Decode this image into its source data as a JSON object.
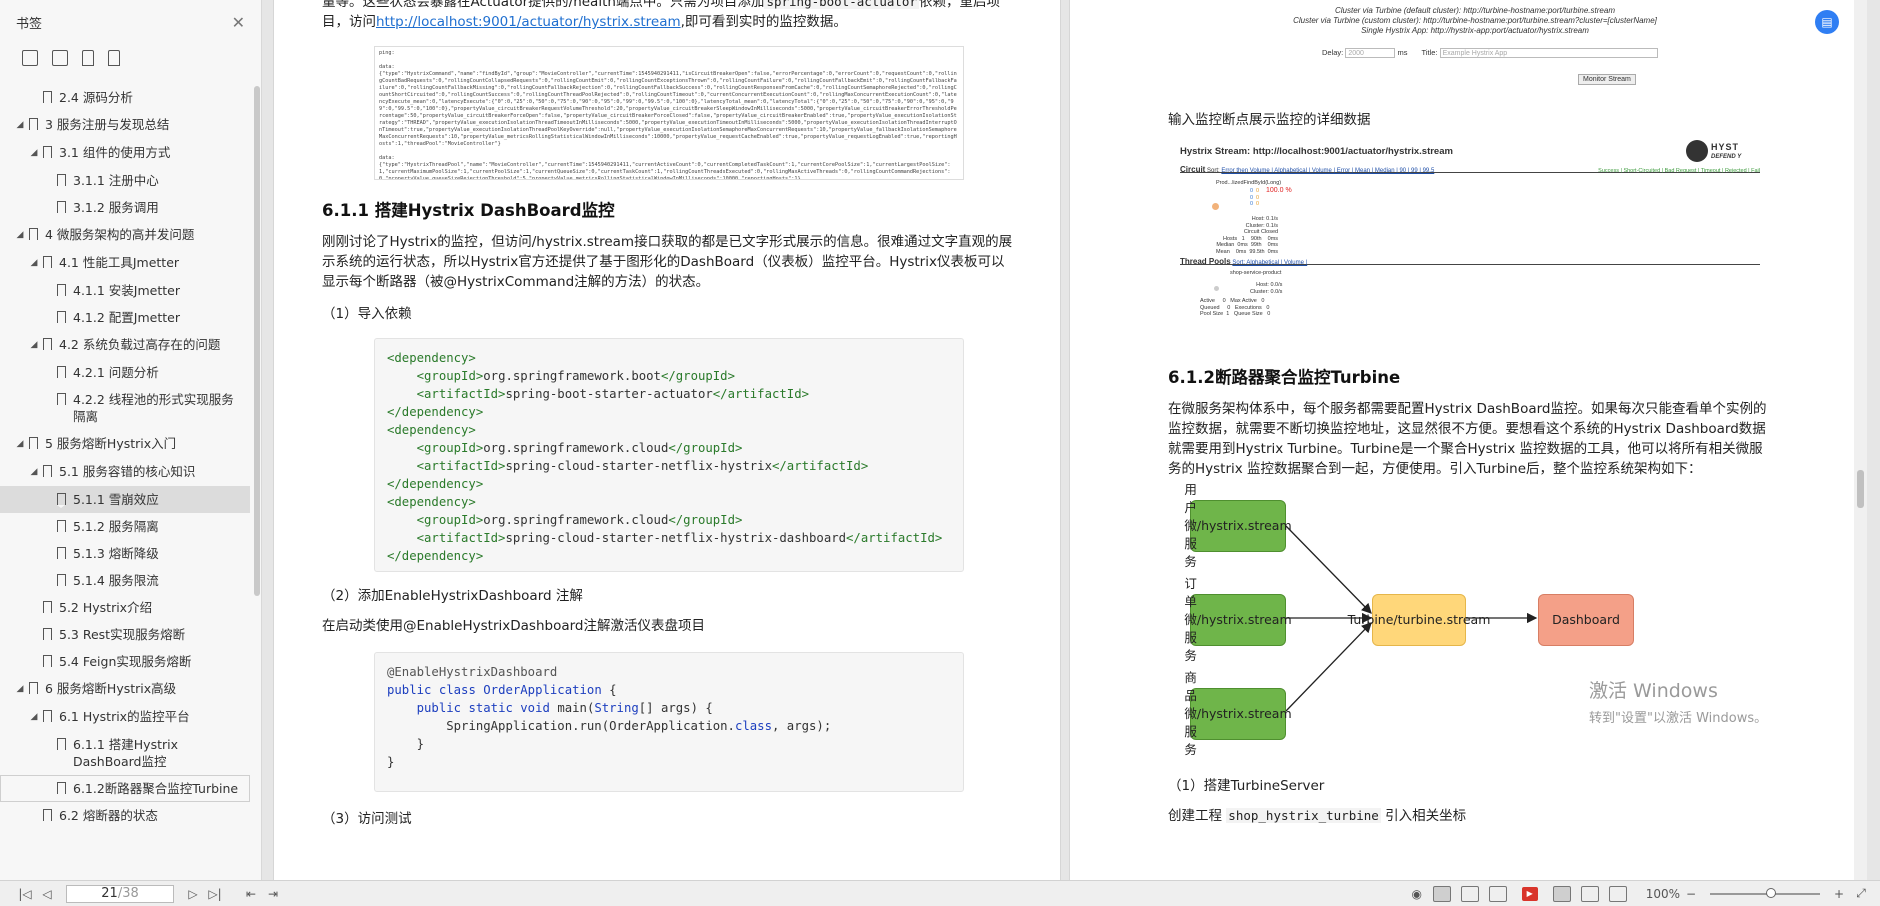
{
  "sidebar": {
    "title": "书签",
    "close_icon": "close-icon",
    "tools": [
      "expand-all-icon",
      "collapse-all-icon",
      "add-bookmark-icon",
      "bookmark-icon"
    ],
    "items": [
      {
        "label": "2.4 源码分析",
        "level": 2,
        "arrow": ""
      },
      {
        "label": "3 服务注册与发现总结",
        "level": 1,
        "arrow": "◢"
      },
      {
        "label": "3.1 组件的使用方式",
        "level": 2,
        "arrow": "◢"
      },
      {
        "label": "3.1.1 注册中心",
        "level": 3,
        "arrow": ""
      },
      {
        "label": "3.1.2 服务调用",
        "level": 3,
        "arrow": ""
      },
      {
        "label": "4 微服务架构的高并发问题",
        "level": 1,
        "arrow": "◢"
      },
      {
        "label": "4.1 性能工具Jmetter",
        "level": 2,
        "arrow": "◢"
      },
      {
        "label": "4.1.1 安装Jmetter",
        "level": 3,
        "arrow": ""
      },
      {
        "label": "4.1.2 配置Jmetter",
        "level": 3,
        "arrow": ""
      },
      {
        "label": "4.2 系统负载过高存在的问题",
        "level": 2,
        "arrow": "◢"
      },
      {
        "label": "4.2.1 问题分析",
        "level": 3,
        "arrow": ""
      },
      {
        "label": "4.2.2 线程池的形式实现服务隔离",
        "level": 3,
        "arrow": ""
      },
      {
        "label": "5 服务熔断Hystrix入门",
        "level": 1,
        "arrow": "◢"
      },
      {
        "label": "5.1 服务容错的核心知识",
        "level": 2,
        "arrow": "◢"
      },
      {
        "label": "5.1.1 雪崩效应",
        "level": 3,
        "arrow": "",
        "selected": true
      },
      {
        "label": "5.1.2 服务隔离",
        "level": 3,
        "arrow": ""
      },
      {
        "label": "5.1.3 熔断降级",
        "level": 3,
        "arrow": ""
      },
      {
        "label": "5.1.4 服务限流",
        "level": 3,
        "arrow": ""
      },
      {
        "label": "5.2 Hystrix介绍",
        "level": 2,
        "arrow": ""
      },
      {
        "label": "5.3 Rest实现服务熔断",
        "level": 2,
        "arrow": ""
      },
      {
        "label": "5.4 Feign实现服务熔断",
        "level": 2,
        "arrow": ""
      },
      {
        "label": "6 服务熔断Hystrix高级",
        "level": 1,
        "arrow": "◢"
      },
      {
        "label": "6.1 Hystrix的监控平台",
        "level": 2,
        "arrow": "◢"
      },
      {
        "label": "6.1.1 搭建Hystrix DashBoard监控",
        "level": 3,
        "arrow": ""
      },
      {
        "label": "6.1.2断路器聚合监控Turbine",
        "level": 3,
        "arrow": "",
        "boxed": true
      },
      {
        "label": "6.2 熔断器的状态",
        "level": 2,
        "arrow": ""
      }
    ]
  },
  "left_page": {
    "intro_1": "量等。这些状态会暴露在Actuator提供的/health端点中。只需为项目添加",
    "intro_code": "spring-boot-actuator",
    "intro_2": "依赖，重启项目，访问",
    "intro_link": "http://localhost:9001/actuator/hystrix.stream",
    "intro_3": ",即可看到实时的监控数据。",
    "raw_lines": [
      "ping:",
      "",
      "data:",
      "{\"type\":\"HystrixCommand\",\"name\":\"findById\",\"group\":\"MovieController\",\"currentTime\":1545940291411,\"isCircuitBreakerOpen\":false,\"errorPercentage\":0,\"errorCount\":0,\"requestCount\":0,\"rollingCountBadRequests\":0,\"rollingCountCollapsedRequests\":0,\"rollingCountEmit\":0,\"rollingCountExceptionsThrown\":0,\"rollingCountFailure\":0,\"rollingCountFallbackEmit\":0,\"rollingCountFallbackFailure\":0,\"rollingCountFallbackMissing\":0,\"rollingCountFallbackRejection\":0,\"rollingCountFallbackSuccess\":0,\"rollingCountResponsesFromCache\":0,\"rollingCountSemaphoreRejected\":0,\"rollingCountShortCircuited\":0,\"rollingCountSuccess\":0,\"rollingCountThreadPoolRejected\":0,\"rollingCountTimeout\":0,\"currentConcurrentExecutionCount\":0,\"rollingMaxConcurrentExecutionCount\":0,\"latencyExecute_mean\":0,\"latencyExecute\":{\"0\":0,\"25\":0,\"50\":0,\"75\":0,\"90\":0,\"95\":0,\"99\":0,\"99.5\":0,\"100\":0},\"latencyTotal_mean\":0,\"latencyTotal\":{\"0\":0,\"25\":0,\"50\":0,\"75\":0,\"90\":0,\"95\":0,\"99\":0,\"99.5\":0,\"100\":0},\"propertyValue_circuitBreakerRequestVolumeThreshold\":20,\"propertyValue_circuitBreakerSleepWindowInMilliseconds\":5000,\"propertyValue_circuitBreakerErrorThresholdPercentage\":50,\"propertyValue_circuitBreakerForceOpen\":false,\"propertyValue_circuitBreakerForceClosed\":false,\"propertyValue_circuitBreakerEnabled\":true,\"propertyValue_executionIsolationStrategy\":\"THREAD\",\"propertyValue_executionIsolationThreadTimeoutInMilliseconds\":5000,\"propertyValue_executionTimeoutInMilliseconds\":5000,\"propertyValue_executionIsolationThreadInterruptOnTimeout\":true,\"propertyValue_executionIsolationThreadPoolKeyOverride\":null,\"propertyValue_executionIsolationSemaphoreMaxConcurrentRequests\":10,\"propertyValue_fallbackIsolationSemaphoreMaxConcurrentRequests\":10,\"propertyValue_metricsRollingStatisticalWindowInMilliseconds\":10000,\"propertyValue_requestCacheEnabled\":true,\"propertyValue_requestLogEnabled\":true,\"reportingHosts\":1,\"threadPool\":\"MovieController\"}",
      "",
      "data:",
      "{\"type\":\"HystrixThreadPool\",\"name\":\"MovieController\",\"currentTime\":1545940291411,\"currentActiveCount\":0,\"currentCompletedTaskCount\":1,\"currentCorePoolSize\":1,\"currentLargestPoolSize\":1,\"currentMaximumPoolSize\":1,\"currentPoolSize\":1,\"currentQueueSize\":0,\"currentTaskCount\":1,\"rollingCountThreadsExecuted\":0,\"rollingMaxActiveThreads\":0,\"rollingCountCommandRejections\":0,\"propertyValue_queueSizeRejectionThreshold\":5,\"propertyValue_metricsRollingStatisticalWindowInMilliseconds\":10000,\"reportingHosts\":1}"
    ],
    "heading_611": "6.1.1 搭建Hystrix DashBoard监控",
    "para_611": "刚刚讨论了Hystrix的监控，但访问/hystrix.stream接口获取的都是已文字形式展示的信息。很难通过文字直观的展示系统的运行状态，所以Hystrix官方还提供了基于图形化的DashBoard（仪表板）监控平台。Hystrix仪表板可以显示每个断路器（被@HystrixCommand注解的方法）的状态。",
    "step1": "（1）导入依赖",
    "step2": "（2）添加EnableHystrixDashboard 注解",
    "step2_desc": "在启动类使用@EnableHystrixDashboard注解激活仪表盘项目",
    "step3": "（3）访问测试"
  },
  "deps": [
    {
      "groupId": "org.springframework.boot",
      "artifactId": "spring-boot-starter-actuator"
    },
    {
      "groupId": "org.springframework.cloud",
      "artifactId": "spring-cloud-starter-netflix-hystrix"
    },
    {
      "groupId": "org.springframework.cloud",
      "artifactId": "spring-cloud-starter-netflix-hystrix-dashboard"
    }
  ],
  "java_code": {
    "annotation": "@EnableHystrixDashboard",
    "kw_public": "public",
    "kw_class": "class",
    "class_name": "OrderApplication",
    "kw_static": "static",
    "kw_void": "void",
    "method": "main",
    "param_type": "String",
    "param": "[] args",
    "run_line": "SpringApplication.run(OrderApplication.",
    "run_class": "class",
    "run_tail": ", args);"
  },
  "right_page": {
    "turbine_default": "Cluster via Turbine (default cluster): http://turbine-hostname:port/turbine.stream",
    "turbine_custom": "Cluster via Turbine (custom cluster): http://turbine-hostname:port/turbine.stream?cluster=[clusterName]",
    "single_app": "Single Hystrix App: http://hystrix-app:port/actuator/hystrix.stream",
    "delay_label": "Delay:",
    "delay_value": "2000",
    "delay_unit": "ms",
    "title_label": "Title:",
    "title_placeholder": "Example Hystrix App",
    "monitor_button": "Monitor Stream",
    "caption": "输入监控断点展示监控的详细数据",
    "hs_title": "Hystrix Stream: http://localhost:9001/actuator/hystrix.stream",
    "hs_logo_1": "HYST",
    "hs_logo_2": "DEFEND Y",
    "hs_circuit": "Circuit",
    "hs_sort": "Sort:",
    "hs_sort_links": "Error then Volume | Alphabetical | Volume | Error | Mean | Median | 90 | 99 | 99.5",
    "hs_legend": "Success | Short-Circuited | Bad Request | Timeout | Rejected | Fail",
    "hs_cmd": "Prod...lizedFindById(Long)",
    "hs_pct": "100.0 %",
    "hs_circuit_block": "Host: 0.1/s\nCluster: 0.1/s\nCircuit Closed\nHosts   1    90th    0ms\nMedian  0ms  99th    0ms\nMean    0ms  99.5th  0ms",
    "hs_threadpools": "Thread Pools",
    "hs_tp_sort": "Sort: Alphabetical | Volume |",
    "hs_tp_name": "shop-service-product",
    "hs_tp_block": "Host: 0.0/s\nCluster: 0.0/s",
    "hs_tp_stats": "Active     0   Max Active   0\nQueued     0   Executions   0\nPool Size  1   Queue Size   0",
    "heading_612": "6.1.2断路器聚合监控Turbine",
    "para_612": "在微服务架构体系中，每个服务都需要配置Hystrix DashBoard监控。如果每次只能查看单个实例的监控数据，就需要不断切换监控地址，这显然很不方便。要想看这个系统的Hystrix Dashboard数据就需要用到Hystrix Turbine。Turbine是一个聚合Hystrix 监控数据的工具，他可以将所有相关微服务的Hystrix 监控数据聚合到一起，方便使用。引入Turbine后，整个监控系统架构如下：",
    "diagram": {
      "user": [
        "用户微服务",
        "/hystrix.stream"
      ],
      "order": [
        "订单微服务",
        "/hystrix.stream"
      ],
      "product": [
        "商品微服务",
        "/hystrix.stream"
      ],
      "turbine": [
        "Turbine",
        "/turbine.stream"
      ],
      "dashboard": "Dashboard"
    },
    "step1": "（1）搭建TurbineServer",
    "step1_desc_1": "创建工程",
    "step1_code": "shop_hystrix_turbine",
    "step1_desc_2": "引入相关坐标"
  },
  "watermark": {
    "line1": "激活 Windows",
    "line2": "转到\"设置\"以激活 Windows。"
  },
  "bottombar": {
    "current_page": "21",
    "total_pages": "/38",
    "zoom": "100%",
    "zoom_percent": 100
  },
  "colors": {
    "link": "#1f6fd0",
    "node_green": "#6fb54a",
    "node_yellow": "#ffd77a",
    "node_salmon": "#f4a088",
    "selected_item": "#dcdcdc"
  }
}
